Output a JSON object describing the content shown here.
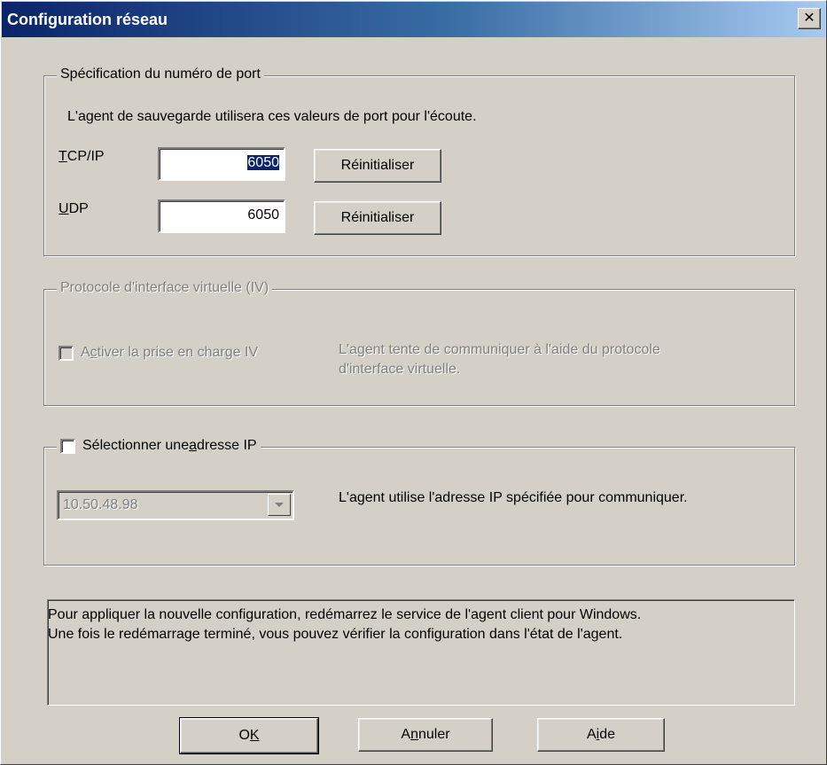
{
  "window": {
    "title": "Configuration réseau",
    "close_label": "✕"
  },
  "port_group": {
    "legend": "Spécification du numéro de port",
    "description": "L'agent de sauvegarde utilisera ces valeurs de port pour l'écoute.",
    "tcp": {
      "label_mnemonic": "T",
      "label_rest": "CP/IP",
      "value": "6050",
      "reset_label": "Réinitialiser"
    },
    "udp": {
      "label_mnemonic": "U",
      "label_rest": "DP",
      "value": "6050",
      "reset_label": "Réinitialiser"
    }
  },
  "iv_group": {
    "legend": "Protocole d'interface virtuelle (IV)",
    "checkbox_pre": "A",
    "checkbox_mnemonic": "c",
    "checkbox_post": "tiver la prise en charge IV",
    "description_line1": "L'agent tente de communiquer à l'aide du protocole",
    "description_line2": "d'interface virtuelle."
  },
  "ip_group": {
    "checkbox_pre": "Sélectionner une ",
    "checkbox_mnemonic": "a",
    "checkbox_post": "dresse IP",
    "combo_value": "10.50.48.98",
    "description": "L'agent utilise l'adresse IP spécifiée pour communiquer."
  },
  "info_box": {
    "line1": "Pour appliquer la nouvelle configuration, redémarrez le service de l'agent client pour Windows.",
    "line2": "Une fois le redémarrage terminé, vous pouvez vérifier la configuration dans l'état de l'agent."
  },
  "buttons": {
    "ok_pre": "O",
    "ok_mnemonic": "K",
    "ok_post": "",
    "cancel_pre": "A",
    "cancel_mnemonic": "n",
    "cancel_post": "nuler",
    "help_pre": "A",
    "help_mnemonic": "i",
    "help_post": "de"
  }
}
